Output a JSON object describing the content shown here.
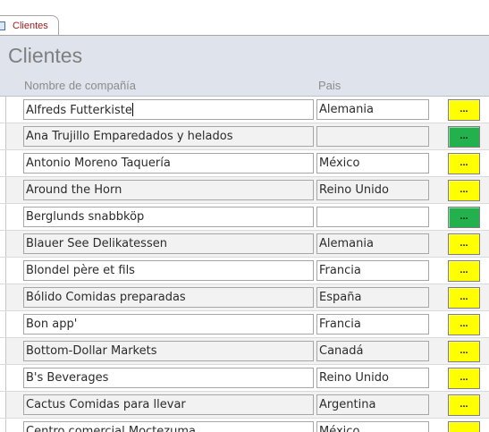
{
  "tab": {
    "label": "Clientes"
  },
  "form": {
    "title": "Clientes",
    "columns": {
      "company": "Nombre de compañía",
      "country": "Pais"
    }
  },
  "colors": {
    "button_yellow": "#ffff00",
    "button_green": "#22b14c"
  },
  "records": [
    {
      "company": "Alfreds Futterkiste",
      "country": "Alemania",
      "button": "...",
      "button_color": "yellow"
    },
    {
      "company": "Ana Trujillo Emparedados y helados",
      "country": "",
      "button": "...",
      "button_color": "green"
    },
    {
      "company": "Antonio Moreno Taquería",
      "country": "México",
      "button": "...",
      "button_color": "yellow"
    },
    {
      "company": "Around the Horn",
      "country": "Reino Unido",
      "button": "...",
      "button_color": "yellow"
    },
    {
      "company": "Berglunds snabbköp",
      "country": "",
      "button": "...",
      "button_color": "green"
    },
    {
      "company": "Blauer See Delikatessen",
      "country": "Alemania",
      "button": "...",
      "button_color": "yellow"
    },
    {
      "company": "Blondel père et fils",
      "country": "Francia",
      "button": "...",
      "button_color": "yellow"
    },
    {
      "company": "Bólido Comidas preparadas",
      "country": "España",
      "button": "...",
      "button_color": "yellow"
    },
    {
      "company": "Bon app'",
      "country": "Francia",
      "button": "...",
      "button_color": "yellow"
    },
    {
      "company": "Bottom-Dollar Markets",
      "country": "Canadá",
      "button": "...",
      "button_color": "yellow"
    },
    {
      "company": "B's Beverages",
      "country": "Reino Unido",
      "button": "...",
      "button_color": "yellow"
    },
    {
      "company": "Cactus Comidas para llevar",
      "country": "Argentina",
      "button": "...",
      "button_color": "yellow"
    },
    {
      "company": "Centro comercial Moctezuma",
      "country": "México",
      "button": "...",
      "button_color": "yellow"
    }
  ]
}
